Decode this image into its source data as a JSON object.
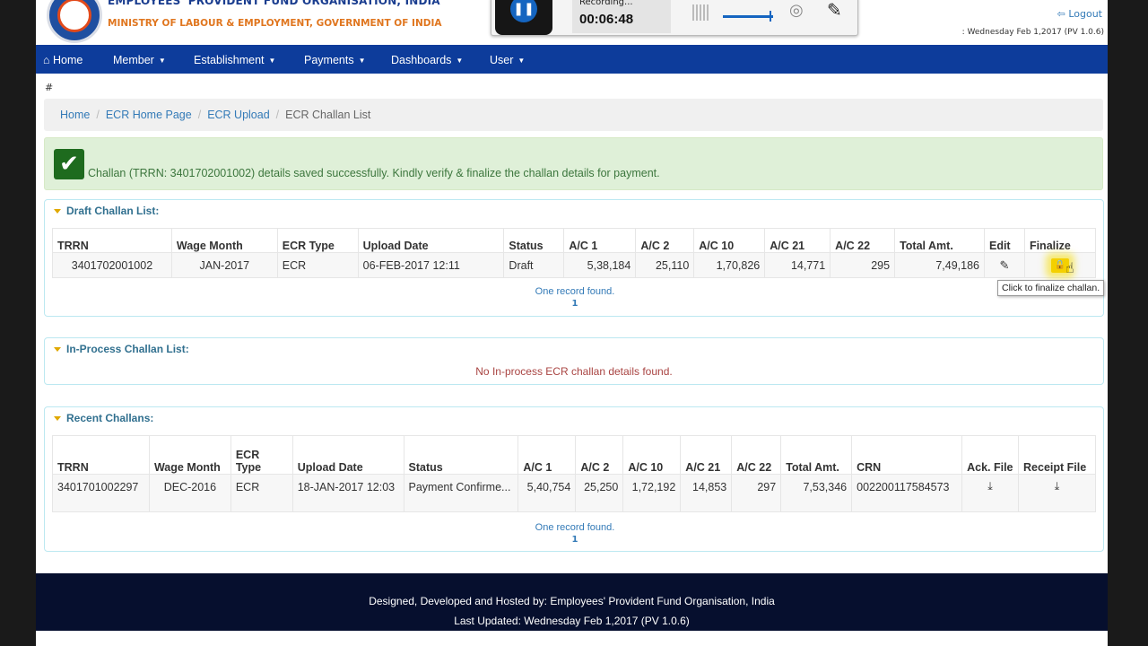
{
  "header": {
    "org_title": "EMPLOYEES' PROVIDENT FUND ORGANISATION, INDIA",
    "ministry": "MINISTRY OF LABOUR & EMPLOYMENT, GOVERNMENT OF INDIA",
    "logout_label": "Logout",
    "date_text": ": Wednesday Feb 1,2017 (PV 1.0.6)"
  },
  "recorder": {
    "status_label": "Recording...",
    "elapsed": "00:06:48",
    "pause_icon": "pause-icon",
    "camera_icon": "webcam-icon",
    "pen_icon": "pen-icon"
  },
  "nav": {
    "items": [
      {
        "label": "Home",
        "icon": "home-icon"
      },
      {
        "label": "Member"
      },
      {
        "label": "Establishment"
      },
      {
        "label": "Payments"
      },
      {
        "label": "Dashboards"
      },
      {
        "label": "User"
      }
    ]
  },
  "hash_text": "#",
  "breadcrumb": {
    "items": [
      "Home",
      "ECR Home Page",
      "ECR Upload"
    ],
    "current": "ECR Challan List"
  },
  "alert": {
    "message": "Challan (TRRN: 3401702001002) details saved successfully. Kindly verify & finalize the challan details for payment."
  },
  "draft": {
    "title": "Draft Challan List:",
    "headers": [
      "TRRN",
      "Wage Month",
      "ECR Type",
      "Upload Date",
      "Status",
      "A/C 1",
      "A/C 2",
      "A/C 10",
      "A/C 21",
      "A/C 22",
      "Total Amt.",
      "Edit",
      "Finalize"
    ],
    "row": {
      "trrn": "3401702001002",
      "wage_month": "JAN-2017",
      "ecr_type": "ECR",
      "upload_date": "06-FEB-2017 12:11",
      "status": "Draft",
      "ac1": "5,38,184",
      "ac2": "25,110",
      "ac10": "1,70,826",
      "ac21": "14,771",
      "ac22": "295",
      "total": "7,49,186"
    },
    "found": "One record found.",
    "page": "1",
    "tooltip": "Click to finalize challan."
  },
  "inprocess": {
    "title": "In-Process Challan List:",
    "message": "No In-process ECR challan details found."
  },
  "recent": {
    "title": "Recent Challans:",
    "headers": {
      "trrn": "TRRN",
      "wage_month": "Wage Month",
      "ecr_type": "ECR Type",
      "upload_date": "Upload Date",
      "status": "Status",
      "ac1": "A/C 1",
      "ac2": "A/C 2",
      "ac10": "A/C 10",
      "ac21": "A/C 21",
      "ac22": "A/C 22",
      "total": "Total Amt.",
      "crn": "CRN",
      "ack": "Ack. File",
      "receipt": "Receipt File"
    },
    "row": {
      "trrn": "3401701002297",
      "wage_month": "DEC-2016",
      "ecr_type": "ECR",
      "upload_date": "18-JAN-2017 12:03",
      "status": "Payment Confirme...",
      "ac1": "5,40,754",
      "ac2": "25,250",
      "ac10": "1,72,192",
      "ac21": "14,853",
      "ac22": "297",
      "total": "7,53,346",
      "crn": "002200117584573"
    },
    "found": "One record found.",
    "page": "1"
  },
  "footer": {
    "line1": "Designed, Developed and Hosted by: Employees' Provident Fund Organisation, India",
    "line2": "Last Updated: Wednesday Feb 1,2017 (PV 1.0.6)"
  }
}
